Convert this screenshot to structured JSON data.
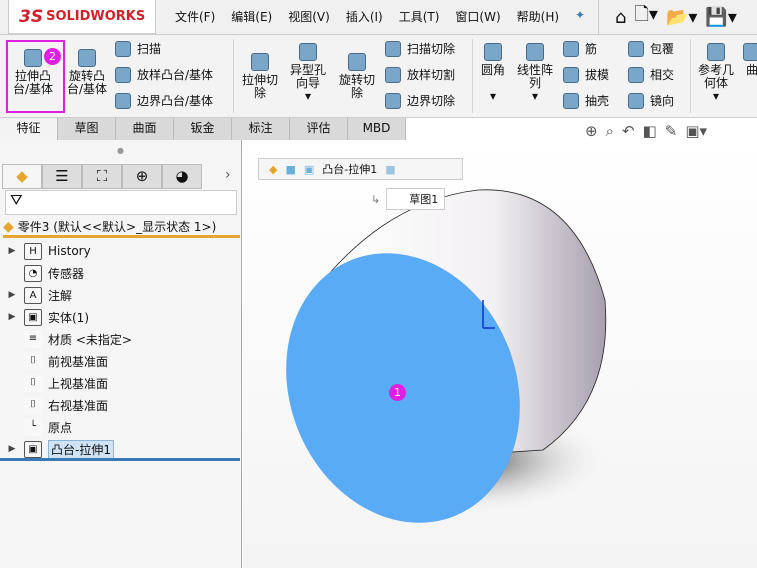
{
  "app": {
    "logo_ds": "3S",
    "logo_text": "SOLIDWORKS"
  },
  "menu": [
    "文件(F)",
    "编辑(E)",
    "视图(V)",
    "插入(I)",
    "工具(T)",
    "窗口(W)",
    "帮助(H)"
  ],
  "ribbon": {
    "extrude_boss": "拉伸凸\n台/基体",
    "revolve_boss": "旋转凸\n台/基体",
    "sweep": "扫描",
    "loft": "放样凸台/基体",
    "boundary": "边界凸台/基体",
    "extrude_cut": "拉伸切\n除",
    "hole_wizard": "异型孔\n向导",
    "revolve_cut": "旋转切\n除",
    "sweep_cut": "扫描切除",
    "loft_cut": "放样切割",
    "boundary_cut": "边界切除",
    "fillet": "圆角",
    "linear_pattern": "线性阵\n列",
    "rib": "筋",
    "draft": "拔模",
    "shell": "抽壳",
    "wrap": "包覆",
    "intersect": "相交",
    "mirror": "镜向",
    "ref_geometry": "参考几\n何体",
    "curves": "曲"
  },
  "tabs": [
    "特征",
    "草图",
    "曲面",
    "钣金",
    "标注",
    "评估",
    "MBD"
  ],
  "badges": {
    "step1": "1",
    "step2": "2"
  },
  "tree": {
    "root": "零件3 (默认<<默认>_显示状态 1>)",
    "items": [
      {
        "label": "History",
        "icon": "H"
      },
      {
        "label": "传感器",
        "icon": "◔"
      },
      {
        "label": "注解",
        "icon": "A"
      },
      {
        "label": "实体(1)",
        "icon": "▣"
      },
      {
        "label": "材质 <未指定>",
        "icon": "≡"
      },
      {
        "label": "前视基准面",
        "icon": "⌷"
      },
      {
        "label": "上视基准面",
        "icon": "⌷"
      },
      {
        "label": "右视基准面",
        "icon": "⌷"
      },
      {
        "label": "原点",
        "icon": "└"
      },
      {
        "label": "凸台-拉伸1",
        "icon": "▣"
      }
    ]
  },
  "breadcrumb": {
    "feature": "凸台-拉伸1",
    "sketch": "草图1"
  },
  "colors": {
    "face": "#5aabf5",
    "highlight": "#e020e0",
    "root_line": "#e5a630"
  }
}
